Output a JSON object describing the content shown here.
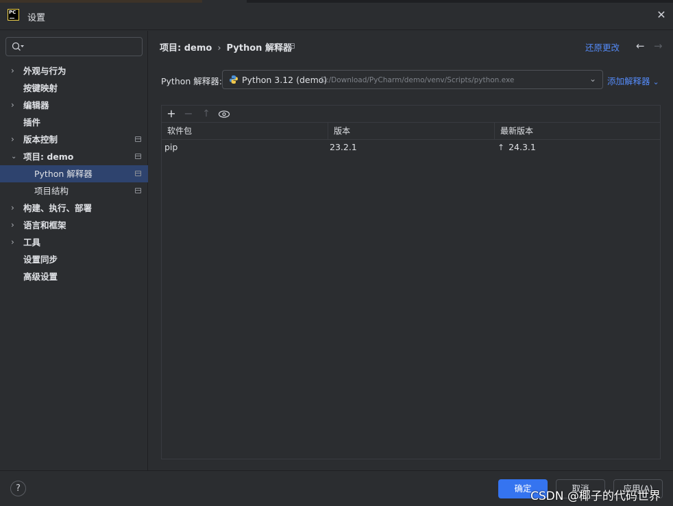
{
  "window": {
    "title": "设置"
  },
  "sidebar": {
    "items": [
      {
        "label": "外观与行为",
        "expandable": true
      },
      {
        "label": "按键映射",
        "expandable": false
      },
      {
        "label": "编辑器",
        "expandable": true
      },
      {
        "label": "插件",
        "expandable": false
      },
      {
        "label": "版本控制",
        "expandable": true
      },
      {
        "label": "项目: demo",
        "expandable": true,
        "expanded": true
      },
      {
        "label": "Python 解释器",
        "child": true,
        "selected": true
      },
      {
        "label": "项目结构",
        "child": true
      },
      {
        "label": "构建、执行、部署",
        "expandable": true
      },
      {
        "label": "语言和框架",
        "expandable": true
      },
      {
        "label": "工具",
        "expandable": true
      },
      {
        "label": "设置同步",
        "expandable": false
      },
      {
        "label": "高级设置",
        "expandable": false
      }
    ]
  },
  "header": {
    "breadcrumb": [
      "项目: demo",
      "Python 解释器"
    ],
    "reset_label": "还原更改"
  },
  "interpreter": {
    "label": "Python 解释器:",
    "name": "Python 3.12 (demo)",
    "path": "D:/Download/PyCharm/demo/venv/Scripts/python.exe",
    "add_label": "添加解释器"
  },
  "packages": {
    "columns": [
      "软件包",
      "版本",
      "最新版本"
    ],
    "rows": [
      {
        "name": "pip",
        "version": "23.2.1",
        "latest": "24.3.1"
      }
    ]
  },
  "footer": {
    "ok_label": "确定",
    "cancel_label": "取消",
    "apply_label": "应用(A)",
    "help_label": "?"
  },
  "watermark": "CSDN @椰子的代码世界",
  "colors": {
    "background": "#2b2d30",
    "accent": "#3574f0",
    "link": "#548af7",
    "selection": "#2e436e"
  }
}
